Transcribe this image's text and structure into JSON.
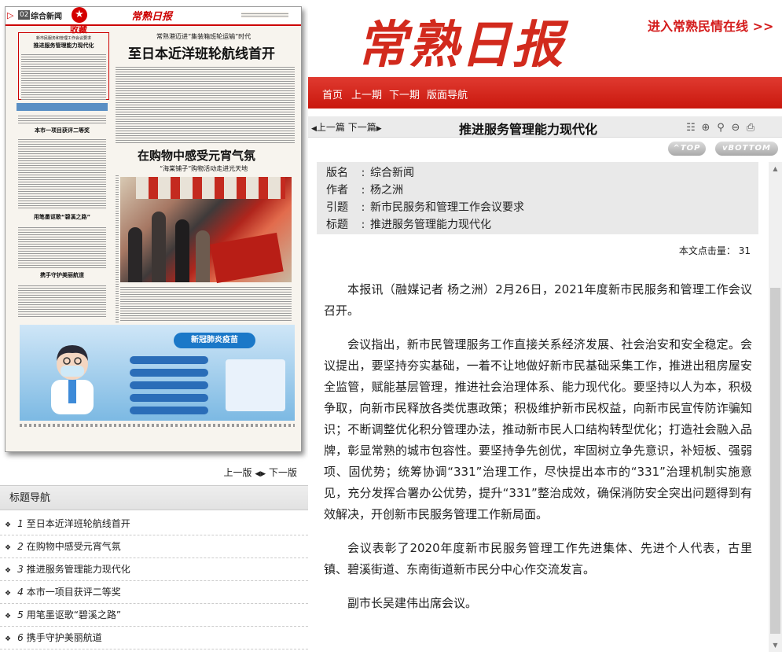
{
  "left": {
    "paper": {
      "section_num": "02",
      "section_name": "综合新闻",
      "masthead": "常熟日报",
      "favorite_label": "收藏",
      "box_kicker": "新市民服务和管理工作会议要求",
      "box_headline": "推进服务管理能力现代化",
      "kicker_1": "常熟港迈进“集装箱班轮运输”时代",
      "headline_1": "至日本近洋班轮航线首开",
      "headline_2": "在购物中感受元宵气氛",
      "subhead_2": "“海棠铺子”购物活动走进光天地",
      "headline_3": "本市一项目获评二等奖",
      "headline_4": "用笔墨讴歌“碧溪之路”",
      "headline_5": "携手守护美丽航道",
      "ad_title": "新冠肺炎疫苗"
    },
    "pager": {
      "prev": "上一版",
      "next": "下一版"
    },
    "topic_nav_title": "标题导航",
    "topics": [
      {
        "num": "1",
        "title": "至日本近洋班轮航线首开"
      },
      {
        "num": "2",
        "title": "在购物中感受元宵气氛"
      },
      {
        "num": "3",
        "title": "推进服务管理能力现代化"
      },
      {
        "num": "4",
        "title": "本市一项目获评二等奖"
      },
      {
        "num": "5",
        "title": "用笔墨讴歌“碧溪之路”"
      },
      {
        "num": "6",
        "title": "携手守护美丽航道"
      }
    ]
  },
  "header": {
    "logo": "常熟日报",
    "enter_link": "进入常熟民情在线 >>",
    "nav": [
      "首页",
      "上一期",
      "下一期",
      "版面导航"
    ]
  },
  "toolbar": {
    "prev": "上一篇",
    "next": "下一篇",
    "title": "推进服务管理能力现代化",
    "icons": [
      "list-icon",
      "zoom-in-icon",
      "magnifier-icon",
      "zoom-out-icon",
      "print-icon"
    ]
  },
  "buttons": {
    "top": "TOP",
    "bottom": "BOTTOM"
  },
  "meta": {
    "section": {
      "key": "版名",
      "value": "综合新闻"
    },
    "author": {
      "key": "作者",
      "value": "杨之洲"
    },
    "lead": {
      "key": "引题",
      "value": "新市民服务和管理工作会议要求"
    },
    "title": {
      "key": "标题",
      "value": "推进服务管理能力现代化"
    }
  },
  "hits": "本文点击量： 31",
  "article": {
    "paragraphs": [
      "本报讯（融媒记者 杨之洲）2月26日，2021年度新市民服务和管理工作会议召开。",
      "会议指出，新市民管理服务工作直接关系经济发展、社会治安和安全稳定。会议提出，要坚持夯实基础，一着不让地做好新市民基础采集工作，推进出租房屋安全监管，赋能基层管理，推进社会治理体系、能力现代化。要坚持以人为本，积极争取，向新市民释放各类优惠政策；积极维护新市民权益，向新市民宣传防诈骗知识；不断调整优化积分管理办法，推动新市民人口结构转型优化；打造社会融入品牌，彰显常熟的城市包容性。要坚持争先创优，牢固树立争先意识，补短板、强弱项、固优势；统筹协调“331”治理工作，尽快提出本市的“331”治理机制实施意见，充分发挥合署办公优势，提升“331”整治成效，确保消防安全突出问题得到有效解决，开创新市民服务管理工作新局面。",
      "会议表彰了2020年度新市民服务管理工作先进集体、先进个人代表，古里镇、碧溪街道、东南街道新市民分中心作交流发言。",
      "副市长吴建伟出席会议。"
    ]
  },
  "colors": {
    "brand_red": "#d22a1d",
    "nav_red": "#c9170d",
    "meta_bg": "#e9e9e9"
  }
}
